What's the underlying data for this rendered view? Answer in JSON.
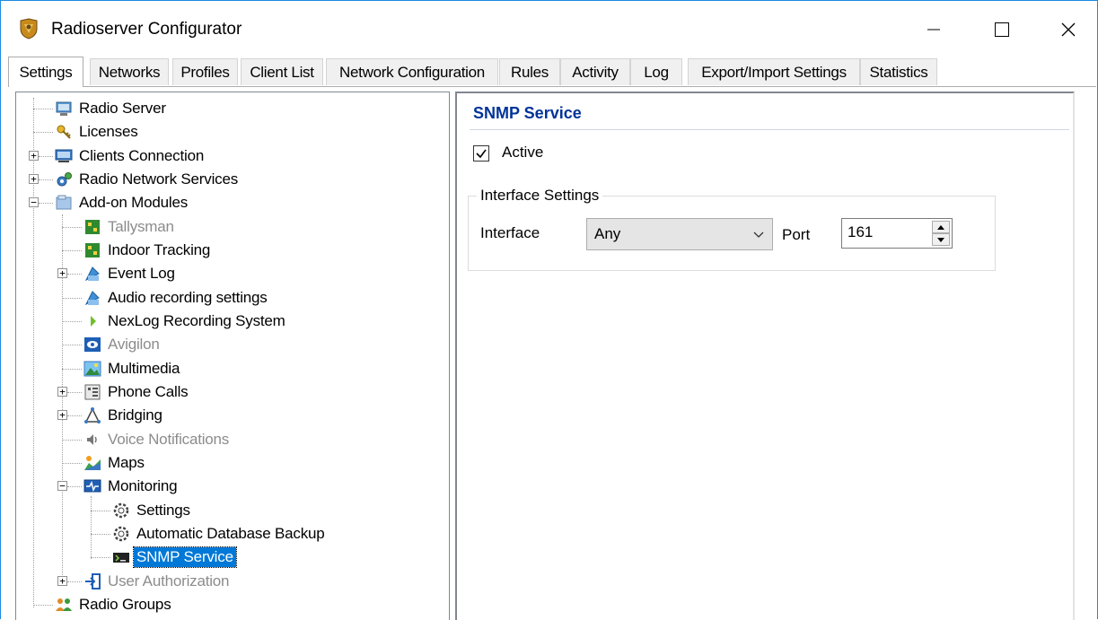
{
  "window": {
    "title": "Radioserver Configurator"
  },
  "tabs": [
    {
      "label": "Settings",
      "active": true
    },
    {
      "label": "Networks"
    },
    {
      "label": "Profiles"
    },
    {
      "label": "Client List"
    },
    {
      "label": "Network Configuration"
    },
    {
      "label": "Rules"
    },
    {
      "label": "Activity"
    },
    {
      "label": "Log"
    },
    {
      "label": "Export/Import Settings"
    },
    {
      "label": "Statistics"
    }
  ],
  "tree": {
    "radio_server": "Radio Server",
    "licenses": "Licenses",
    "clients_connection": "Clients Connection",
    "radio_network_services": "Radio Network Services",
    "addon_modules": "Add-on Modules",
    "tallysman": "Tallysman",
    "indoor_tracking": "Indoor Tracking",
    "event_log": "Event Log",
    "audio_recording": "Audio recording settings",
    "nexlog": "NexLog Recording System",
    "avigilon": "Avigilon",
    "multimedia": "Multimedia",
    "phone_calls": "Phone Calls",
    "bridging": "Bridging",
    "voice_notifications": "Voice Notifications",
    "maps": "Maps",
    "monitoring": "Monitoring",
    "monitoring_settings": "Settings",
    "auto_db_backup": "Automatic Database Backup",
    "snmp_service": "SNMP Service",
    "user_authorization": "User Authorization",
    "radio_groups": "Radio Groups"
  },
  "content": {
    "title": "SNMP Service",
    "active_label": "Active",
    "active_checked": true,
    "interface_group_title": "Interface Settings",
    "interface_label": "Interface",
    "interface_value": "Any",
    "port_label": "Port",
    "port_value": "161"
  },
  "colors": {
    "accent": "#0078d7",
    "title_blue": "#003399",
    "disabled_text": "#8c8c8c",
    "window_border": "#1b8ae0"
  }
}
